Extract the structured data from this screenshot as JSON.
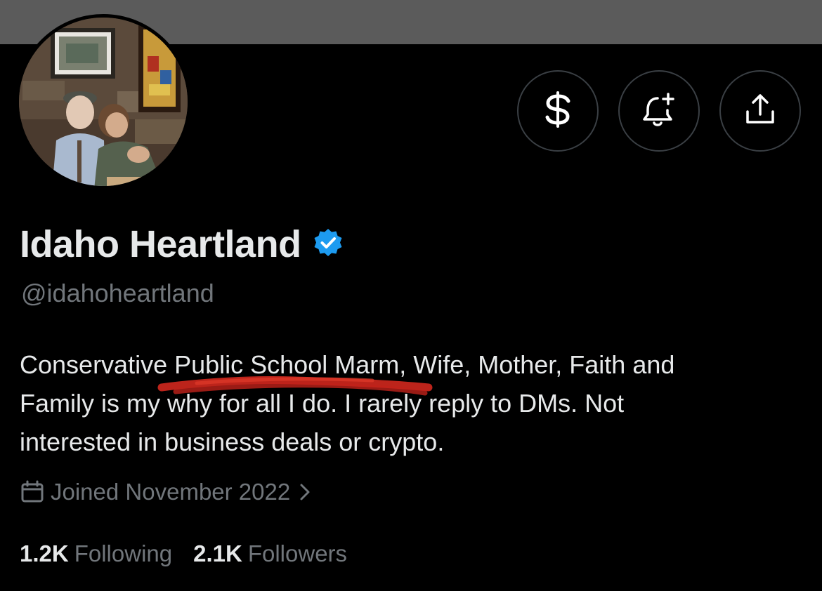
{
  "profile": {
    "display_name": "Idaho Heartland",
    "handle": "@idahoheartland",
    "verified": true,
    "bio_lines": [
      "Conservative Public School Marm, Wife, Mother, Faith and",
      "Family is my why for all I do. I rarely reply to DMs. Not",
      "interested in business deals or crypto."
    ],
    "joined": "Joined November 2022",
    "following_count": "1.2K",
    "following_label": "Following",
    "followers_count": "2.1K",
    "followers_label": "Followers"
  },
  "actions": [
    {
      "name": "subscribe",
      "icon": "dollar-sign-icon"
    },
    {
      "name": "notifications",
      "icon": "bell-plus-icon"
    },
    {
      "name": "share",
      "icon": "share-upload-icon"
    }
  ],
  "colors": {
    "background": "#000000",
    "banner": "#5b5b5b",
    "primary_text": "#e7e9ea",
    "secondary_text": "#71767b",
    "verified_badge": "#1d9bf0",
    "button_border": "#3a3f44",
    "scribble": "#d0281e"
  }
}
